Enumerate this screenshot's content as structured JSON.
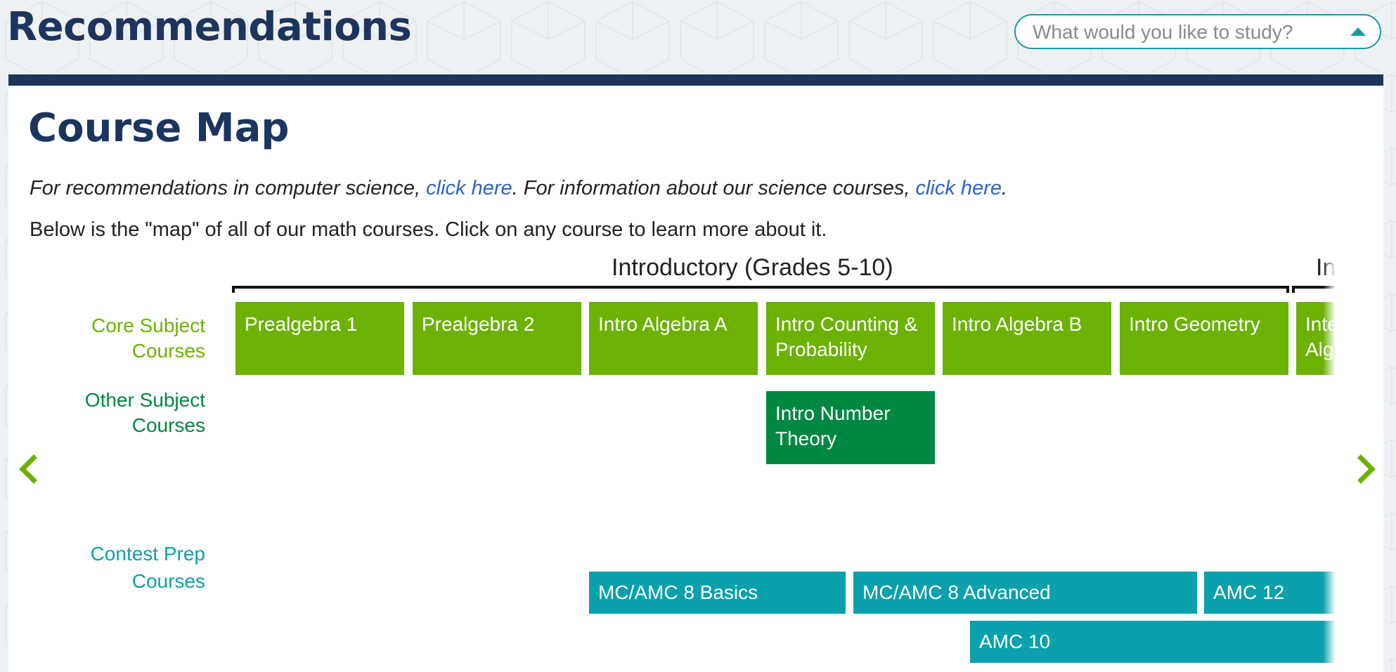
{
  "header": {
    "title": "Recommendations",
    "search_placeholder": "What would you like to study?"
  },
  "course_map": {
    "title": "Course Map",
    "intro": {
      "part1": "For recommendations in computer science, ",
      "link1": "click here",
      "part2": ". For information about our science courses, ",
      "link2": "click here",
      "part3": "."
    },
    "description": "Below is the \"map\" of all of our math courses. Click on any course to learn more about it.",
    "levels": [
      {
        "label": "Introductory (Grades 5-10)"
      },
      {
        "label": "In"
      }
    ],
    "row_labels": {
      "core": [
        "Core Subject",
        "Courses"
      ],
      "other": [
        "Other Subject",
        "Courses"
      ],
      "contest": [
        "Contest Prep",
        "Courses"
      ]
    },
    "core_courses": [
      {
        "lines": [
          "Prealgebra 1"
        ]
      },
      {
        "lines": [
          "Prealgebra 2"
        ]
      },
      {
        "lines": [
          "Intro Algebra A"
        ]
      },
      {
        "lines": [
          "Intro Counting &",
          "Probability"
        ]
      },
      {
        "lines": [
          "Intro Algebra B"
        ]
      },
      {
        "lines": [
          "Intro Geometry"
        ]
      },
      {
        "lines": [
          "Inte",
          "Alg"
        ]
      }
    ],
    "other_courses": [
      {
        "lines": [
          "Intro Number",
          "Theory"
        ]
      }
    ],
    "contest_courses": [
      {
        "label": "MC/AMC 8 Basics"
      },
      {
        "label": "MC/AMC 8 Advanced"
      },
      {
        "label": "AMC 12"
      },
      {
        "label": "AMC 10"
      }
    ]
  },
  "colors": {
    "navy": "#1c355e",
    "core_green": "#6cb204",
    "other_green": "#008842",
    "contest_teal": "#0aa0ac",
    "link_blue": "#2f63c4"
  },
  "icons": {
    "prev": "chevron-left-icon",
    "next": "chevron-right-icon",
    "search_toggle": "caret-up-icon"
  }
}
